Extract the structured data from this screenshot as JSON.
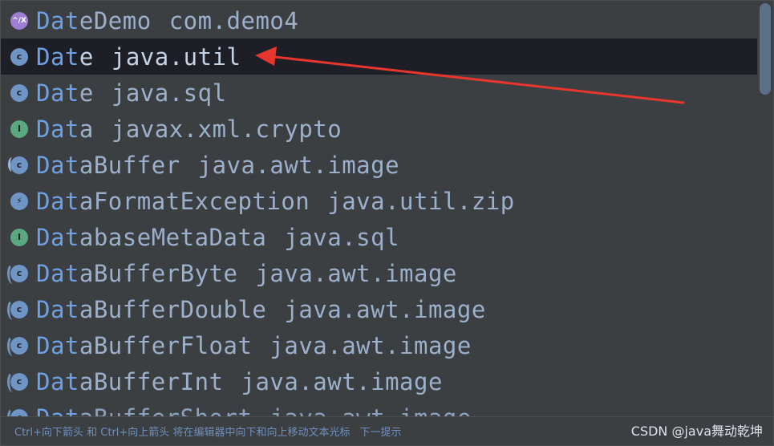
{
  "items": [
    {
      "match": "Dat",
      "rest": "eDemo",
      "pkg": "com.demo4",
      "icon": "kotlin-icon",
      "icon_text": "^/X"
    },
    {
      "match": "Dat",
      "rest": "e",
      "pkg": "java.util",
      "icon": "class-icon",
      "icon_text": "c"
    },
    {
      "match": "Dat",
      "rest": "e",
      "pkg": "java.sql",
      "icon": "class-icon",
      "icon_text": "c"
    },
    {
      "match": "Dat",
      "rest": "a",
      "pkg": "javax.xml.crypto",
      "icon": "interface-icon",
      "icon_text": "I"
    },
    {
      "match": "Dat",
      "rest": "aBuffer",
      "pkg": "java.awt.image",
      "icon": "abstract-class-icon",
      "icon_text": "c"
    },
    {
      "match": "Dat",
      "rest": "aFormatException",
      "pkg": "java.util.zip",
      "icon": "exception-icon",
      "icon_text": "⚡"
    },
    {
      "match": "Dat",
      "rest": "abaseMetaData",
      "pkg": "java.sql",
      "icon": "interface-icon",
      "icon_text": "I"
    },
    {
      "match": "Dat",
      "rest": "aBufferByte",
      "pkg": "java.awt.image",
      "icon": "class-icon",
      "icon_text": "c"
    },
    {
      "match": "Dat",
      "rest": "aBufferDouble",
      "pkg": "java.awt.image",
      "icon": "class-icon",
      "icon_text": "c"
    },
    {
      "match": "Dat",
      "rest": "aBufferFloat",
      "pkg": "java.awt.image",
      "icon": "class-icon",
      "icon_text": "c"
    },
    {
      "match": "Dat",
      "rest": "aBufferInt",
      "pkg": "java.awt.image",
      "icon": "class-icon",
      "icon_text": "c"
    },
    {
      "match": "Dat",
      "rest": "aBufferShort",
      "pkg": "java.awt.image",
      "icon": "class-icon",
      "icon_text": "c"
    }
  ],
  "selected_index": 1,
  "footer": {
    "hint": "Ctrl+向下箭头 和 Ctrl+向上箭头 将在编辑器中向下和向上移动文本光标",
    "next": "下一提示"
  },
  "watermark": "CSDN @java舞动乾坤",
  "colors": {
    "background": "#3c3f41",
    "selected_row": "#1e1f26",
    "text": "#9cb0cc",
    "match_text": "#6ea0e6",
    "arrow": "#e8362e",
    "scroll_thumb": "#5b6f88"
  }
}
